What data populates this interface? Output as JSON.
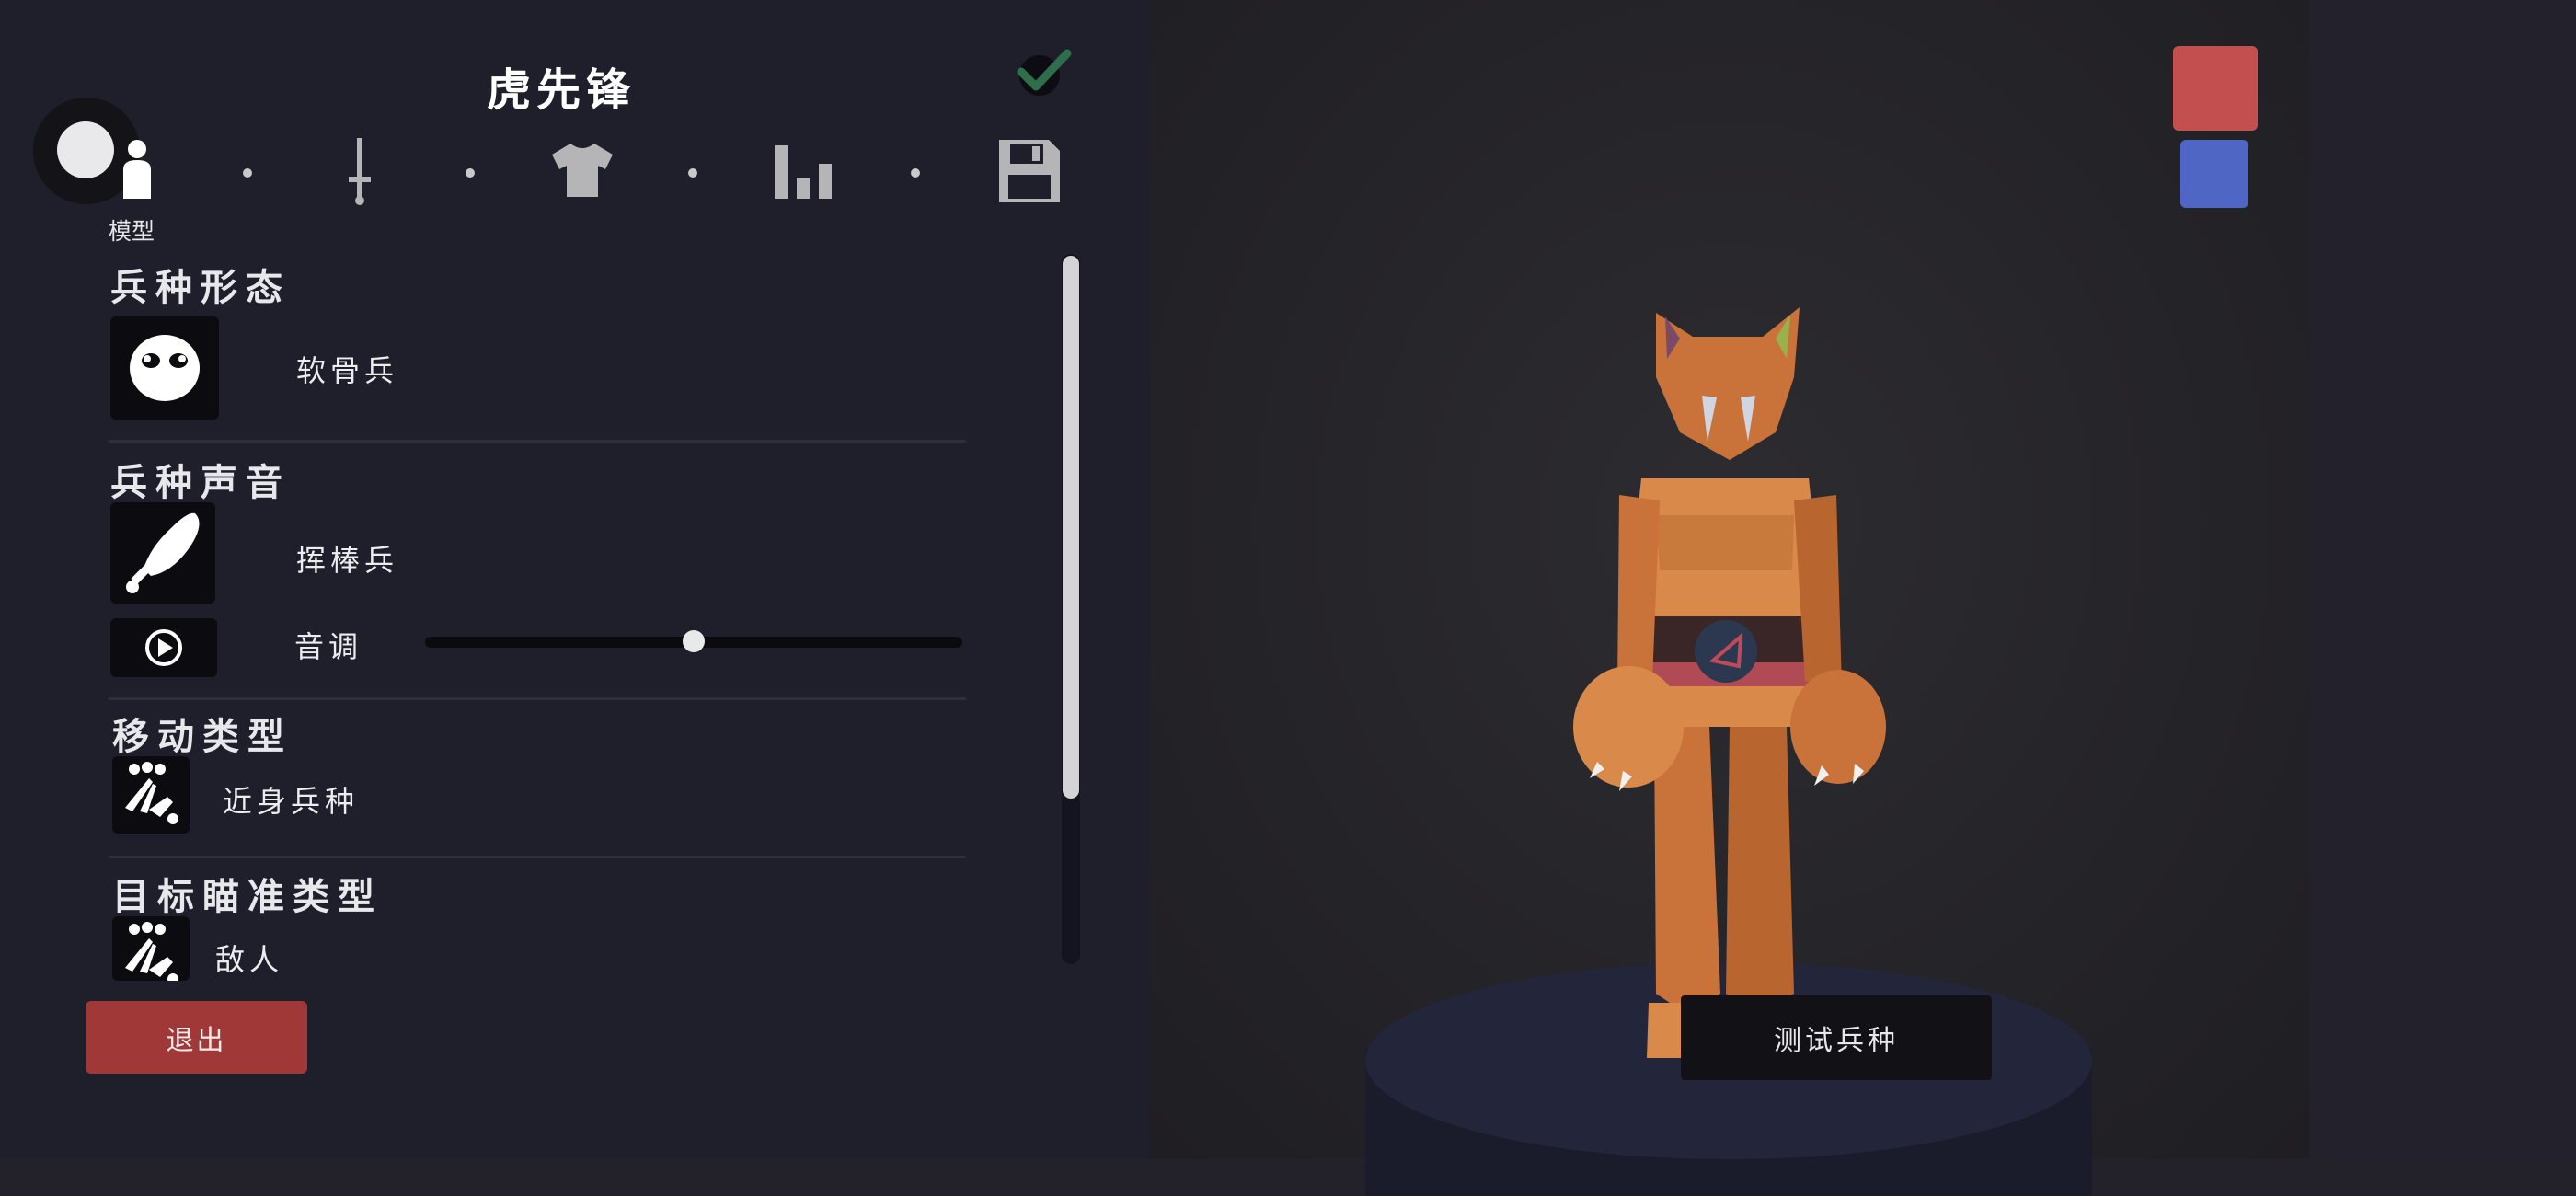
{
  "editor": {
    "title": "虎先锋",
    "tabs": [
      {
        "name": "model",
        "icon": "person-icon",
        "label": "模型",
        "active": true
      },
      {
        "name": "weapon",
        "icon": "sword-icon"
      },
      {
        "name": "clothing",
        "icon": "shirt-icon"
      },
      {
        "name": "stats",
        "icon": "bar-chart-icon"
      },
      {
        "name": "save",
        "icon": "save-icon"
      }
    ]
  },
  "sections": {
    "unit_form": {
      "title": "兵种形态",
      "value": "软骨兵",
      "icon": "ragdoll-face-icon"
    },
    "unit_voice": {
      "title": "兵种声音",
      "value": "挥棒兵",
      "icon": "drumstick-icon",
      "pitch_label": "音调",
      "pitch_level": 0.5
    },
    "movement_type": {
      "title": "移动类型",
      "value": "近身兵种",
      "icon": "melee-unit-icon"
    },
    "targeting_type": {
      "title": "目标瞄准类型",
      "value": "敌人",
      "icon": "melee-unit-icon"
    }
  },
  "buttons": {
    "exit": "退出",
    "test_unit": "测试兵种"
  },
  "teams": [
    {
      "name": "red",
      "color": "#c44f4f"
    },
    {
      "name": "blue",
      "color": "#4f66c4"
    }
  ],
  "colors": {
    "panel_bg": "#1f1e2b",
    "exit_button": "#a13838",
    "confirm_check": "#2e6e4a"
  }
}
